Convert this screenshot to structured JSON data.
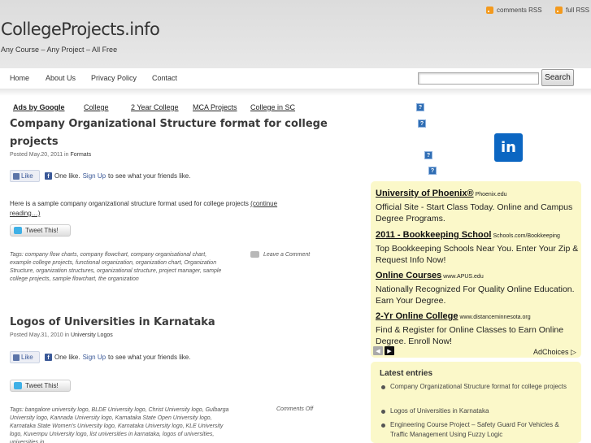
{
  "header": {
    "site_title": "CollegeProjects.info",
    "tagline": "Any Course – Any Project – All Free",
    "rss_comments": "comments RSS",
    "rss_full": "full RSS"
  },
  "nav": {
    "items": [
      "Home",
      "About Us",
      "Privacy Policy",
      "Contact"
    ],
    "search_value": "",
    "search_button": "Search"
  },
  "ad_links": [
    "Ads by Google",
    "College",
    "2 Year College",
    "MCA Projects",
    "College in SC"
  ],
  "posts": [
    {
      "title_line1": "Company Organizational Structure format for college",
      "title_line2": "projects",
      "posted": "Posted May.20, 2011 in",
      "category": "Formats",
      "like_label": "Like",
      "fb_text": "One like.",
      "fb_signup": "Sign Up",
      "fb_suffix": "to see what your friends like.",
      "body": "Here is a sample company organizational structure format used for college projects",
      "more": "(continue reading…)",
      "tweet": "Tweet This!",
      "tags": "Tags: company flow charts, company flowchart, company organisational chart, example college projects, functional organization, organization chart, Organization Structure, organization structures, organizational structure, project manager, sample college projects, sample flowchart, the organization",
      "comments": "Leave a Comment"
    },
    {
      "title": "Logos of Universities in Karnataka",
      "posted": "Posted May.31, 2010 in",
      "category": "University Logos",
      "like_label": "Like",
      "fb_text": "One like.",
      "fb_signup": "Sign Up",
      "fb_suffix": "to see what your friends like.",
      "tweet": "Tweet This!",
      "tags": "Tags: bangalore university logo, BLDE University logo, Christ University logo, Gulbarga University logo, Kannada University logo, Karnataka State Open University logo, Karnataka State Women's University logo, Karnataka University logo, KLE University logo, Kuvempu University logo, list universities in karnataka, logos of universities, universities in",
      "comments": "Comments Off"
    }
  ],
  "sidebar": {
    "linkedin_label": "in",
    "ads": [
      {
        "title": "University of Phoenix®",
        "domain": "Phoenix.edu",
        "desc": "Official Site - Start Class Today. Online and Campus Degree Programs."
      },
      {
        "title": "2011 - Bookkeeping School",
        "domain": "Schools.com/Bookkeeping",
        "desc": "Top Bookkeeping Schools Near You. Enter Your Zip & Request Info Now!"
      },
      {
        "title": "Online Courses",
        "domain": "www.APUS.edu",
        "desc": "Nationally Recognized For Quality Online Education. Earn Your Degree."
      },
      {
        "title": "2-Yr Online College",
        "domain": "www.distanceminnesota.org",
        "desc": "Find & Register for Online Classes to Earn Online Degree. Enroll Now!"
      }
    ],
    "adchoices": "AdChoices ▷",
    "latest_title": "Latest entries",
    "latest": [
      "Company Organizational Structure format for college projects",
      "Logos of Universities in Karnataka",
      "Engineering Course Project – Safety Guard For Vehicles & Traffic Management Using Fuzzy Logic"
    ]
  },
  "colors": {
    "header_bg": "#dcdcdc",
    "ad_box_bg": "#fbf8c9",
    "linkedin": "#0b66c2",
    "facebook": "#3b5998",
    "rss": "#f39a1e"
  },
  "icons": [
    "rss-icon",
    "linkedin-icon",
    "facebook-icon",
    "twitter-icon",
    "like-thumb-icon",
    "comment-bubble-icon",
    "help-icon"
  ]
}
